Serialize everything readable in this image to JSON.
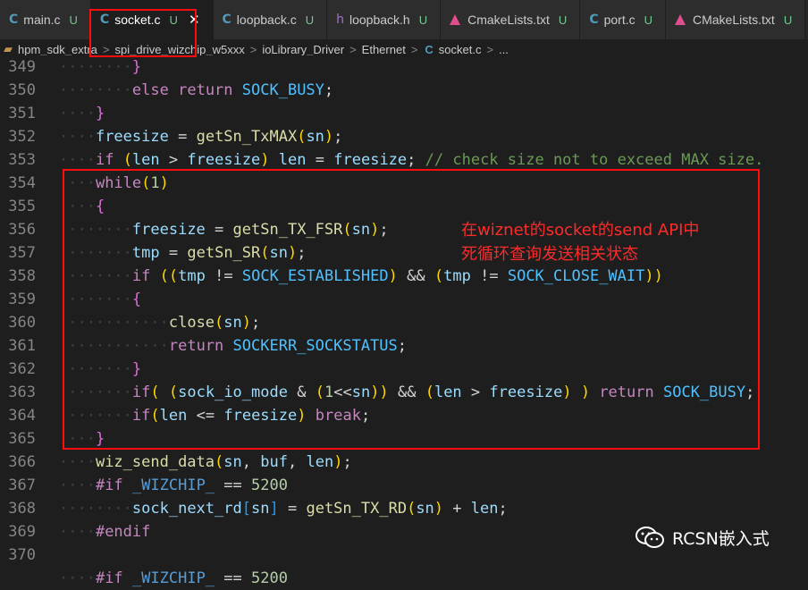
{
  "tabs": [
    {
      "icon": "C",
      "label": "main.c",
      "badge": "U",
      "active": false
    },
    {
      "icon": "C",
      "label": "socket.c",
      "badge": "U",
      "active": true,
      "close": "✕"
    },
    {
      "icon": "C",
      "label": "loopback.c",
      "badge": "U",
      "active": false
    },
    {
      "icon": "h",
      "label": "loopback.h",
      "badge": "U",
      "active": false
    },
    {
      "icon": "cmake",
      "label": "CmakeLists.txt",
      "badge": "U",
      "active": false
    },
    {
      "icon": "C",
      "label": "port.c",
      "badge": "U",
      "active": false
    },
    {
      "icon": "cmake",
      "label": "CMakeLists.txt",
      "badge": "U",
      "active": false
    }
  ],
  "breadcrumb": {
    "items": [
      "hpm_sdk_extra",
      "spi_drive_wizchip_w5xxx",
      "ioLibrary_Driver",
      "Ethernet",
      "socket.c",
      "..."
    ],
    "separator": ">"
  },
  "code": {
    "line_numbers": [
      "349",
      "350",
      "351",
      "352",
      "353",
      "354",
      "355",
      "356",
      "357",
      "358",
      "359",
      "360",
      "361",
      "362",
      "363",
      "364",
      "365",
      "366",
      "367",
      "368",
      "369",
      "370"
    ],
    "lines": [
      "        }",
      "        else return SOCK_BUSY;",
      "    }",
      "    freesize = getSn_TxMAX(sn);",
      "    if (len > freesize) len = freesize; // check size not to exceed MAX size.",
      "    while(1)",
      "    {",
      "        freesize = getSn_TX_FSR(sn);",
      "        tmp = getSn_SR(sn);",
      "        if ((tmp != SOCK_ESTABLISHED) && (tmp != SOCK_CLOSE_WAIT))",
      "        {",
      "            close(sn);",
      "            return SOCKERR_SOCKSTATUS;",
      "        }",
      "        if( (sock_io_mode & (1<<sn)) && (len > freesize) ) return SOCK_BUSY;",
      "        if(len <= freesize) break;",
      "    }",
      "    wiz_send_data(sn, buf, len);",
      "    #if _WIZCHIP_ == 5200",
      "        sock_next_rd[sn] = getSn_TX_RD(sn) + len;",
      "    #endif",
      "",
      "    #if _WIZCHIP_ == 5200"
    ]
  },
  "annotation": {
    "line1": "在wiznet的socket的send API中",
    "line2": "死循环查询发送相关状态"
  },
  "watermark": {
    "text": "RCSN嵌入式"
  },
  "colors": {
    "highlight": "#ff0d0d",
    "annotation": "#ff2a2a"
  }
}
